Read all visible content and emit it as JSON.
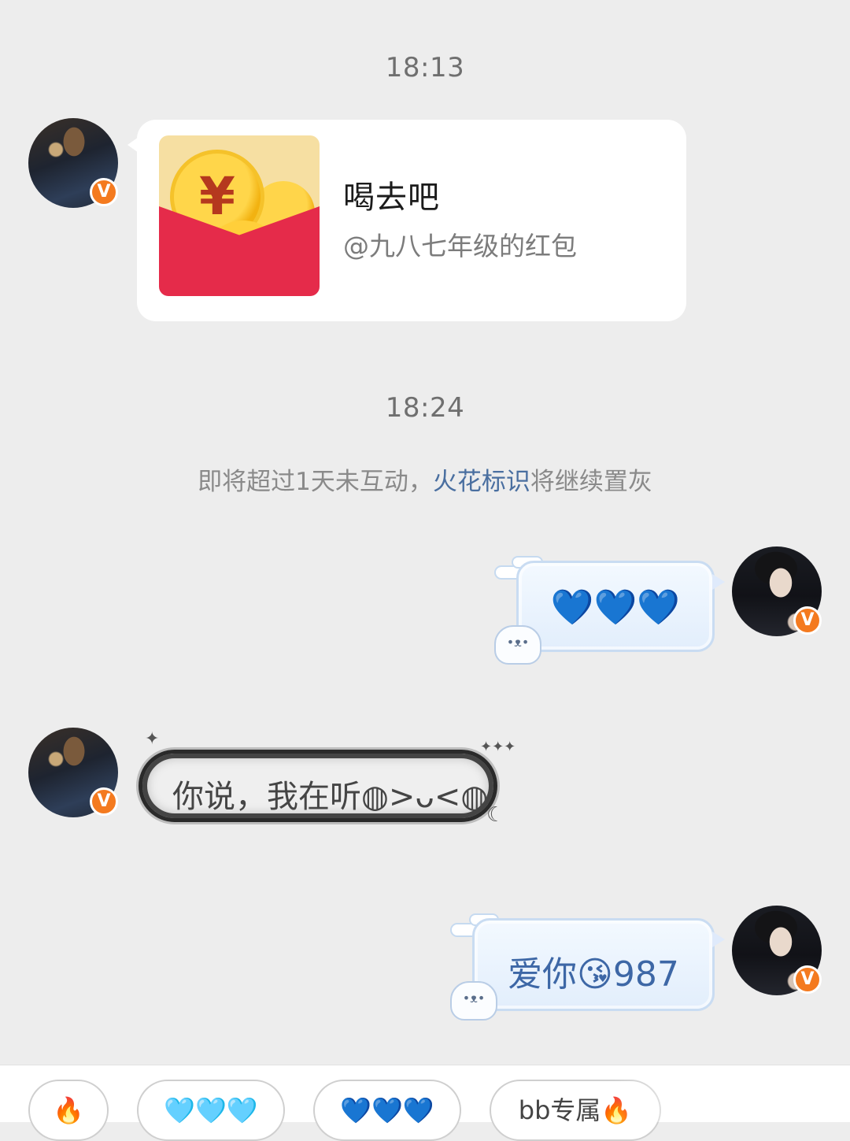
{
  "timestamps": [
    "18:13",
    "18:24"
  ],
  "notice": {
    "prefix": "即将超过1天未互动，",
    "link": "火花标识",
    "suffix": "将继续置灰"
  },
  "messages": [
    {
      "from": "other",
      "type": "red_packet",
      "title": "喝去吧",
      "subtitle": "@九八七年级的红包"
    },
    {
      "from": "self",
      "type": "text",
      "text": "💙💙💙"
    },
    {
      "from": "other",
      "type": "text",
      "text": "你说，我在听◍>ᴗ<◍"
    },
    {
      "from": "self",
      "type": "text",
      "text": "爱你😘987"
    }
  ],
  "verified_badge": "V",
  "red_packet_symbol": "¥",
  "quick_replies": [
    "🔥",
    "🩵🩵🩵",
    "💙💙💙",
    "bb专属🔥"
  ],
  "colors": {
    "background": "#ededed",
    "red_packet": "#e52b4a",
    "badge": "#f47a1f",
    "link": "#4a6fa0",
    "cloud_text": "#3d67a6"
  }
}
